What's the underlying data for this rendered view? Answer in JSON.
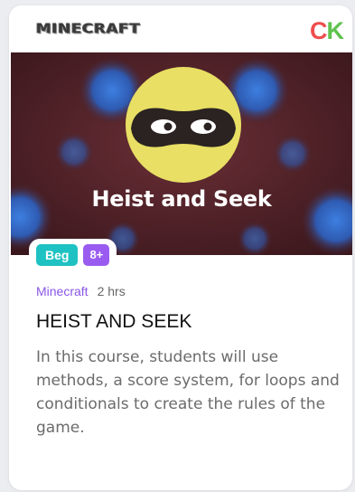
{
  "header": {
    "brand_logo_text": "MINECRAFT",
    "ck_logo": {
      "c": "C",
      "k": "K"
    }
  },
  "hero": {
    "title": "Heist and Seek",
    "image_icon": "masked-face-icon"
  },
  "badges": {
    "level": "Beg",
    "age": "8+"
  },
  "meta": {
    "category": "Minecraft",
    "duration": "2 hrs"
  },
  "course": {
    "title": "HEIST AND SEEK",
    "description": "In this course, students will use methods, a score system, for loops and conditionals to create the rules of the game."
  },
  "colors": {
    "level_badge": "#1fc2c2",
    "age_badge": "#9a5cf0",
    "category_text": "#8a57e8",
    "ck_c": "#ef4d4d",
    "ck_k": "#5fc24e"
  }
}
